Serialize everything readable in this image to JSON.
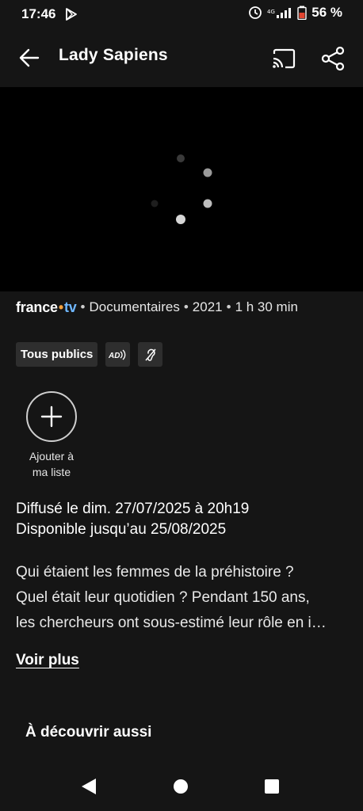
{
  "status_bar": {
    "time": "17:46",
    "battery_percent": "56 %"
  },
  "app_bar": {
    "title": "Lady Sapiens"
  },
  "meta": {
    "logo_france": "france",
    "logo_dot": "•",
    "logo_tv": "tv",
    "separator": "•",
    "genre": "Documentaires",
    "year": "2021",
    "duration": "1 h 30 min"
  },
  "badges": {
    "audience": "Tous publics",
    "audio_description": "AD"
  },
  "add_to_list": {
    "label_line1": "Ajouter à",
    "label_line2": "ma liste"
  },
  "broadcast": {
    "aired": "Diffusé le dim. 27/07/2025 à 20h19",
    "available": "Disponible jusqu’au 25/08/2025"
  },
  "description": {
    "line1": "Qui étaient les femmes de la préhistoire ?",
    "line2": "Quel était leur quotidien ? Pendant 150 ans,",
    "line3": "les chercheurs ont sous-estimé leur rôle en i…"
  },
  "voir_plus": "Voir plus",
  "discover_title": "À découvrir aussi",
  "colors": {
    "background": "#151515",
    "player": "#000000",
    "badge_bg": "#2e2e2e",
    "logo_dot": "#f2a03d",
    "logo_tv": "#6fb7ff"
  }
}
